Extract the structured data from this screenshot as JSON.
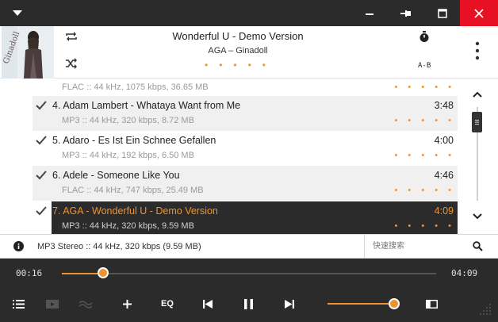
{
  "now_playing": {
    "title": "Wonderful U - Demo Version",
    "artist": "AGA – Ginadoll",
    "ab_label": "A-B"
  },
  "playlist": [
    {
      "title": "",
      "duration": "",
      "details": "FLAC :: 44 kHz, 1075 kbps, 36.65 MB",
      "checked": false
    },
    {
      "title": "4. Adam Lambert - Whataya Want from Me",
      "duration": "3:48",
      "details": "MP3 :: 44 kHz, 320 kbps, 8.72 MB",
      "checked": true
    },
    {
      "title": "5. Adaro - Es Ist Ein Schnee Gefallen",
      "duration": "4:00",
      "details": "MP3 :: 44 kHz, 192 kbps, 6.50 MB",
      "checked": true
    },
    {
      "title": "6. Adele - Someone Like You",
      "duration": "4:46",
      "details": "FLAC :: 44 kHz, 747 kbps, 25.49 MB",
      "checked": true
    },
    {
      "title": "7. AGA - Wonderful U - Demo Version",
      "duration": "4:09",
      "details": "MP3 :: 44 kHz, 320 kbps, 9.59 MB",
      "checked": true
    }
  ],
  "rating_dots": "• • • • •",
  "status": {
    "format_text": "MP3 Stereo  ::  44 kHz, 320 kbps (9.59 MB)",
    "search_placeholder": "快速搜索"
  },
  "seek": {
    "current_time": "00:16",
    "total_time": "04:09",
    "progress": 0.11
  },
  "controls": {
    "eq_label": "EQ",
    "volume": 0.84
  },
  "colors": {
    "accent": "#f0922e",
    "dark_bg": "#2b2b2b",
    "close_red": "#e81123"
  }
}
